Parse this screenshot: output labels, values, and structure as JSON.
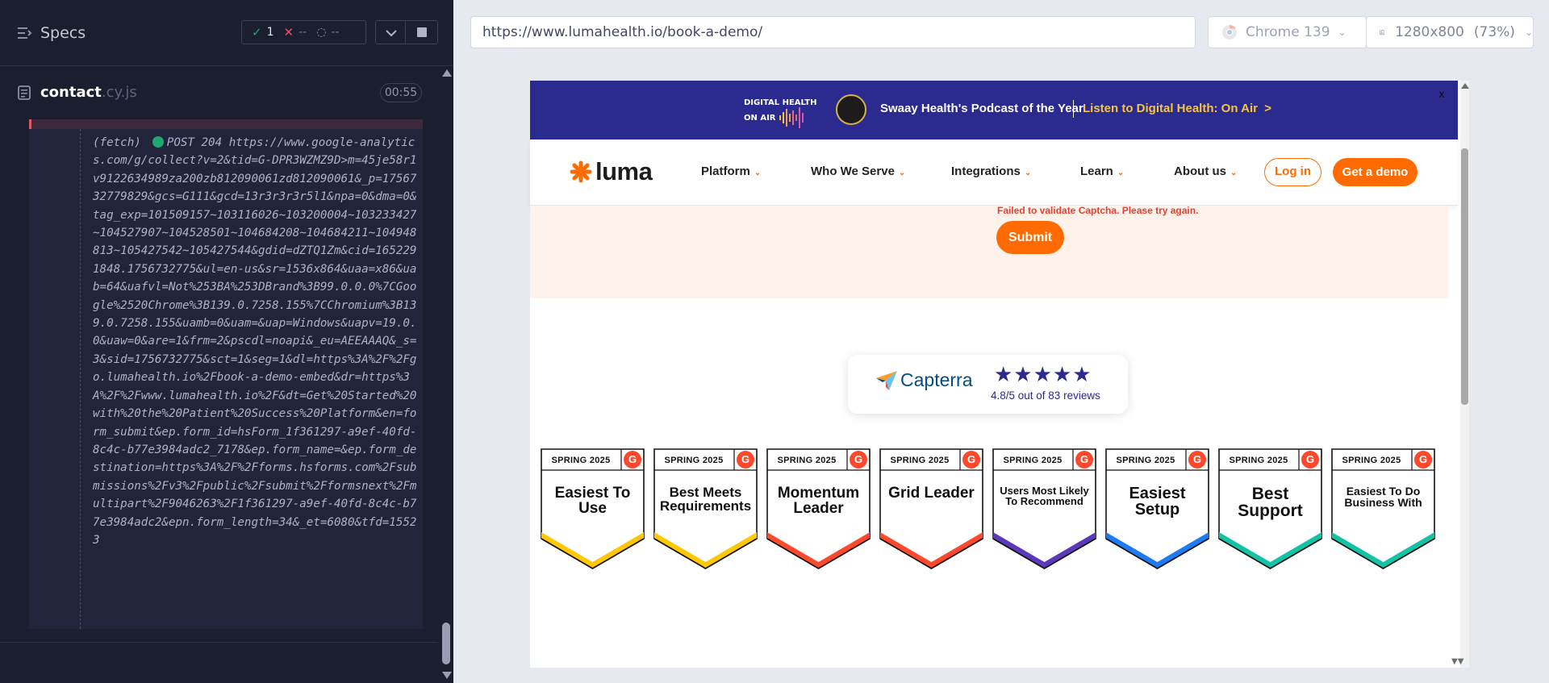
{
  "runner": {
    "specs_label": "Specs",
    "stats": {
      "passed": "1",
      "failed": "--",
      "pending": "--"
    },
    "spec": {
      "name": "contact",
      "ext": ".cy.js",
      "duration": "00:55"
    },
    "log": {
      "prefix": "(fetch)",
      "method": "POST 204",
      "text": "https://www.google-analytics.com/g/collect?v=2&tid=G-DPR3WZMZ9D>m=45je58r1v9122634989za200zb812090061zd812090061&_p=1756732779829&gcs=G111&gcd=13r3r3r3r5l1&npa=0&dma=0&tag_exp=101509157~103116026~103200004~103233427~104527907~104528501~104684208~104684211~104948813~105427542~105427544&gdid=dZTQ1Zm&cid=1652291848.1756732775&ul=en-us&sr=1536x864&uaa=x86&uab=64&uafvl=Not%253BA%253DBrand%3B99.0.0.0%7CGoogle%2520Chrome%3B139.0.7258.155%7CChromium%3B139.0.7258.155&uamb=0&uam=&uap=Windows&uapv=19.0.0&uaw=0&are=1&frm=2&pscdl=noapi&_eu=AEEAAAQ&_s=3&sid=1756732775&sct=1&seg=1&dl=https%3A%2F%2Fgo.lumahealth.io%2Fbook-a-demo-embed&dr=https%3A%2F%2Fwww.lumahealth.io%2F&dt=Get%20Started%20with%20the%20Patient%20Success%20Platform&en=form_submit&ep.form_id=hsForm_1f361297-a9ef-40fd-8c4c-b77e3984adc2_7178&ep.form_name=&ep.form_destination=https%3A%2F%2Fforms.hsforms.com%2Fsubmissions%2Fv3%2Fpublic%2Fsubmit%2Fformsnext%2Fmultipart%2F9046263%2F1f361297-a9ef-40fd-8c4c-b77e3984adc2&epn.form_length=34&_et=6080&tfd=15523"
    }
  },
  "browser": {
    "url": "https://www.lumahealth.io/book-a-demo/",
    "browser_name": "Chrome 139",
    "viewport": "1280x800",
    "zoom": "(73%)"
  },
  "site": {
    "announcement": {
      "logo_line1": "DIGITAL HEALTH",
      "logo_line2": "ON AIR",
      "text": "Swaay Health's Podcast of the Year",
      "link": "Listen to Digital Health: On Air",
      "link_arrow": ">",
      "close": "x"
    },
    "nav": {
      "brand": "luma",
      "items": [
        "Platform",
        "Who We Serve",
        "Integrations",
        "Learn",
        "About us"
      ],
      "login": "Log in",
      "demo": "Get a demo"
    },
    "form": {
      "error": "Failed to validate Captcha. Please try again.",
      "submit": "Submit"
    },
    "capterra": {
      "brand": "Capterra",
      "stars": "★★★★★",
      "rating": "4.8/5 out of 83 reviews"
    },
    "badges": [
      {
        "season": "SPRING 2025",
        "title": "Easiest To Use",
        "color": "#ffc800"
      },
      {
        "season": "SPRING 2025",
        "title": "Best Meets Requirements",
        "color": "#ffc800"
      },
      {
        "season": "SPRING 2025",
        "title": "Momentum Leader",
        "color": "#ff492c"
      },
      {
        "season": "SPRING 2025",
        "title": "Grid Leader",
        "color": "#ff492c"
      },
      {
        "season": "SPRING 2025",
        "title": "Users Most Likely To Recommend",
        "color": "#5a39ba"
      },
      {
        "season": "SPRING 2025",
        "title": "Easiest Setup",
        "color": "#1e7bf2"
      },
      {
        "season": "SPRING 2025",
        "title": "Best Support",
        "color": "#12c4a5"
      },
      {
        "season": "SPRING 2025",
        "title": "Easiest To Do Business With",
        "color": "#12c4a5"
      }
    ],
    "colors": {
      "brand_orange": "#ff6b00",
      "announce_bg": "#2b2a8f",
      "link_yellow": "#f6c53f",
      "form_bg": "#fff2ea",
      "error_red": "#e8402f"
    }
  }
}
